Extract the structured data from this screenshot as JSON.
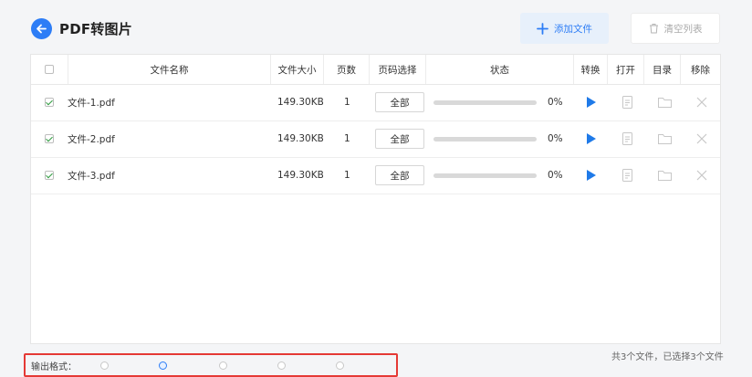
{
  "header": {
    "title": "PDF转图片",
    "add_label": "添加文件",
    "clear_label": "清空列表"
  },
  "table": {
    "columns": [
      "文件名称",
      "文件大小",
      "页数",
      "页码选择",
      "状态",
      "转换",
      "打开",
      "目录",
      "移除"
    ],
    "rows": [
      {
        "name": "文件-1.pdf",
        "size": "149.30KB",
        "pages": "1",
        "selection": "全部",
        "progress": "0%"
      },
      {
        "name": "文件-2.pdf",
        "size": "149.30KB",
        "pages": "1",
        "selection": "全部",
        "progress": "0%"
      },
      {
        "name": "文件-3.pdf",
        "size": "149.30KB",
        "pages": "1",
        "selection": "全部",
        "progress": "0%"
      }
    ]
  },
  "footer": {
    "summary": "共3个文件，已选择3个文件",
    "output_label": "输出格式："
  },
  "colors": {
    "accent": "#2d7df6",
    "highlight_border": "#e53935"
  }
}
